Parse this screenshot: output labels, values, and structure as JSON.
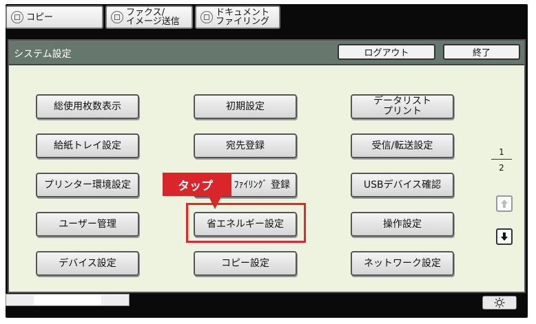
{
  "tabs": [
    {
      "label": "コピー"
    },
    {
      "label": "ファクス/\nイメージ送信"
    },
    {
      "label": "ドキュメント\nファイリング"
    }
  ],
  "header": {
    "title": "システム設定",
    "logout_label": "ログアウト",
    "exit_label": "終了"
  },
  "menu": {
    "col1": [
      "総使用枚数表示",
      "給紙トレイ設定",
      "プリンター環境設定",
      "ユーザー管理",
      "デバイス設定"
    ],
    "col2": [
      "初期設定",
      "宛先登録",
      "ﾌｧｲﾘﾝｸﾞ 登録",
      "省エネルギー設定",
      "コピー設定"
    ],
    "col3": [
      "データリスト\nプリント",
      "受信/転送設定",
      "USBデバイス確認",
      "操作設定",
      "ネットワーク設定"
    ]
  },
  "pagination": {
    "current": "1",
    "total": "2"
  },
  "callout": {
    "label": "タップ"
  },
  "colors": {
    "header_bg": "#66776d",
    "screen_bg": "#eef3e0",
    "highlight": "#e6272a",
    "callout_bg": "#d8262a"
  },
  "icons": {
    "tab": "copy-icon",
    "up": "arrow-up-icon",
    "down": "arrow-down-icon",
    "brightness": "sun-icon"
  }
}
